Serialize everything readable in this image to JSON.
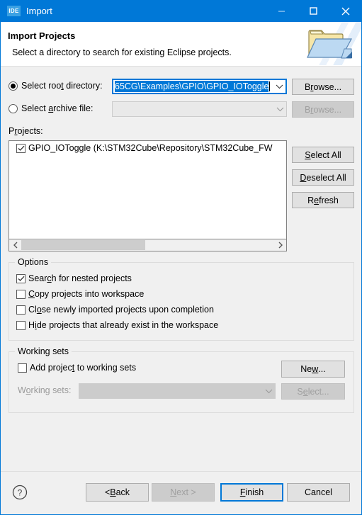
{
  "window": {
    "title": "Import",
    "app_icon_label": "IDE",
    "accent_color": "#0078d7",
    "body_color": "#f0f0f0",
    "controls": {
      "minimize": "minimize",
      "maximize": "maximize",
      "close": "close"
    }
  },
  "header": {
    "title": "Import Projects",
    "description": "Select a directory to search for existing Eclipse projects."
  },
  "source": {
    "root_directory": {
      "label_before": "Select roo",
      "label_mnemonic": "t",
      "label_after": " directory:",
      "selected": true,
      "value": "65CG\\Examples\\GPIO\\GPIO_IOToggle",
      "browse_label_before": "B",
      "browse_mnemonic": "r",
      "browse_label_after": "owse...",
      "browse_enabled": true
    },
    "archive_file": {
      "label_before": "Select ",
      "label_mnemonic": "a",
      "label_after": "rchive file:",
      "selected": false,
      "value": "",
      "browse_label_before": "B",
      "browse_mnemonic": "r",
      "browse_label_after": "owse...",
      "browse_enabled": false
    }
  },
  "projects": {
    "label_before": "P",
    "label_mnemonic": "r",
    "label_after": "ojects:",
    "items": [
      {
        "checked": true,
        "text": "GPIO_IOToggle (K:\\STM32Cube\\Repository\\STM32Cube_FW"
      }
    ],
    "buttons": [
      {
        "before": "",
        "mnemonic": "S",
        "after": "elect All",
        "enabled": true
      },
      {
        "before": "",
        "mnemonic": "D",
        "after": "eselect All",
        "enabled": true
      },
      {
        "before": "R",
        "mnemonic": "e",
        "after": "fresh",
        "enabled": true
      }
    ],
    "scrollbar": {
      "left_arrow": "scroll-left",
      "right_arrow": "scroll-right",
      "thumb_position_percent": 0,
      "thumb_width_percent": 49
    }
  },
  "options": {
    "title": "Options",
    "items": [
      {
        "checked": true,
        "before": "Sear",
        "mnemonic": "c",
        "after": "h for nested projects"
      },
      {
        "checked": false,
        "before": "",
        "mnemonic": "C",
        "after": "opy projects into workspace"
      },
      {
        "checked": false,
        "before": "Cl",
        "mnemonic": "o",
        "after": "se newly imported projects upon completion"
      },
      {
        "checked": false,
        "before": "H",
        "mnemonic": "i",
        "after": "de projects that already exist in the workspace"
      }
    ]
  },
  "working_sets": {
    "title": "Working sets",
    "add_checkbox": {
      "checked": false,
      "before": "Add projec",
      "mnemonic": "t",
      "after": " to working sets"
    },
    "new_button": {
      "before": "Ne",
      "mnemonic": "w",
      "after": "...",
      "enabled": true
    },
    "combo_label": {
      "before": "W",
      "mnemonic": "o",
      "after": "rking sets:",
      "enabled": false
    },
    "combo_value": "",
    "select_button": {
      "before": "S",
      "mnemonic": "e",
      "after": "lect...",
      "enabled": false
    }
  },
  "footer": {
    "help_icon": "help-icon",
    "buttons": [
      {
        "name": "back",
        "before": "< ",
        "mnemonic": "B",
        "after": "ack",
        "enabled": true,
        "default": false
      },
      {
        "name": "next",
        "before": "",
        "mnemonic": "N",
        "after": "ext >",
        "enabled": false,
        "default": false
      },
      {
        "name": "finish",
        "before": "",
        "mnemonic": "F",
        "after": "inish",
        "enabled": true,
        "default": true
      },
      {
        "name": "cancel",
        "before": "Cancel",
        "mnemonic": "",
        "after": "",
        "enabled": true,
        "default": false
      }
    ]
  }
}
